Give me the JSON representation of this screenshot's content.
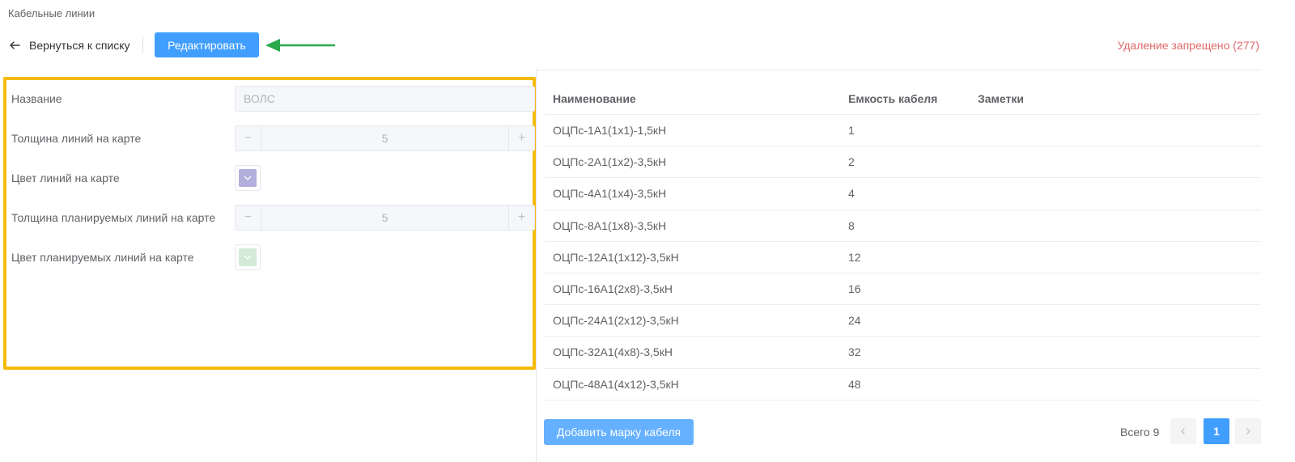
{
  "header": {
    "title": "Кабельные линии",
    "back_label": "Вернуться к списку",
    "edit_label": "Редактировать",
    "delete_note": "Удаление запрещено (277)"
  },
  "form": {
    "name_label": "Название",
    "name_placeholder": "ВОЛС",
    "line_width_label": "Толщина линий на карте",
    "line_width_value": "5",
    "line_color_label": "Цвет линий на карте",
    "line_color": "#b3aedb",
    "planned_width_label": "Толщина планируемых линий на карте",
    "planned_width_value": "5",
    "planned_color_label": "Цвет планируемых линий на карте",
    "planned_color": "#d4ead9",
    "minus_symbol": "−",
    "plus_symbol": "+"
  },
  "table": {
    "columns": [
      "Наименование",
      "Емкость кабеля",
      "Заметки"
    ],
    "rows": [
      {
        "name": "ОЦПс-1А1(1х1)-1,5кН",
        "capacity": "1",
        "notes": ""
      },
      {
        "name": "ОЦПс-2А1(1х2)-3,5кН",
        "capacity": "2",
        "notes": ""
      },
      {
        "name": "ОЦПс-4А1(1х4)-3,5кН",
        "capacity": "4",
        "notes": ""
      },
      {
        "name": "ОЦПс-8А1(1х8)-3,5кН",
        "capacity": "8",
        "notes": ""
      },
      {
        "name": "ОЦПс-12А1(1х12)-3,5кН",
        "capacity": "12",
        "notes": ""
      },
      {
        "name": "ОЦПс-16А1(2х8)-3,5кН",
        "capacity": "16",
        "notes": ""
      },
      {
        "name": "ОЦПс-24А1(2х12)-3,5кН",
        "capacity": "24",
        "notes": ""
      },
      {
        "name": "ОЦПс-32А1(4х8)-3,5кН",
        "capacity": "32",
        "notes": ""
      },
      {
        "name": "ОЦПс-48А1(4х12)-3,5кН",
        "capacity": "48",
        "notes": ""
      }
    ]
  },
  "footer": {
    "add_label": "Добавить марку кабеля",
    "total_label": "Всего 9",
    "current_page": "1"
  },
  "colors": {
    "accent": "#409eff",
    "highlight_border": "#f5bb0a",
    "annotation_arrow": "#2aa84a",
    "danger_text": "#e06969"
  },
  "icons": {
    "back": "arrow-left-icon",
    "arrow": "green-arrow-icon",
    "prev": "chevron-left-icon",
    "next": "chevron-right-icon",
    "dropdown": "chevron-down-icon"
  }
}
